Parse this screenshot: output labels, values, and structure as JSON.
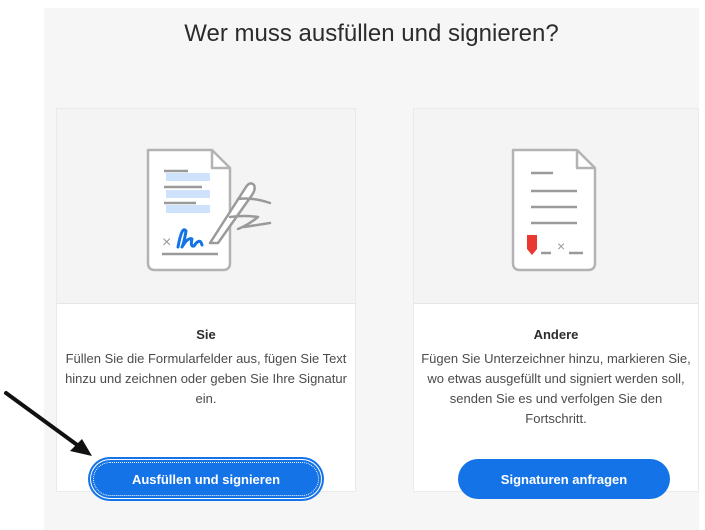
{
  "title": "Wer muss ausfüllen und signieren?",
  "cards": [
    {
      "heading": "Sie",
      "description": "Füllen Sie die Formularfelder aus, fügen Sie Text hinzu und zeichnen oder geben Sie Ihre Signatur ein.",
      "button_label": "Ausfüllen und signieren",
      "icon": "document-signing-hand-icon"
    },
    {
      "heading": "Andere",
      "description": "Fügen Sie Unterzeichner hinzu, markieren Sie, wo etwas ausgefüllt und signiert werden soll, senden Sie es und verfolgen Sie den Fortschritt.",
      "button_label": "Signaturen anfragen",
      "icon": "document-request-signature-icon"
    }
  ],
  "colors": {
    "accent": "#1473e6",
    "highlight": "#cfe2fb",
    "flag": "#e8382f",
    "icon_stroke": "#b3b3b3"
  }
}
